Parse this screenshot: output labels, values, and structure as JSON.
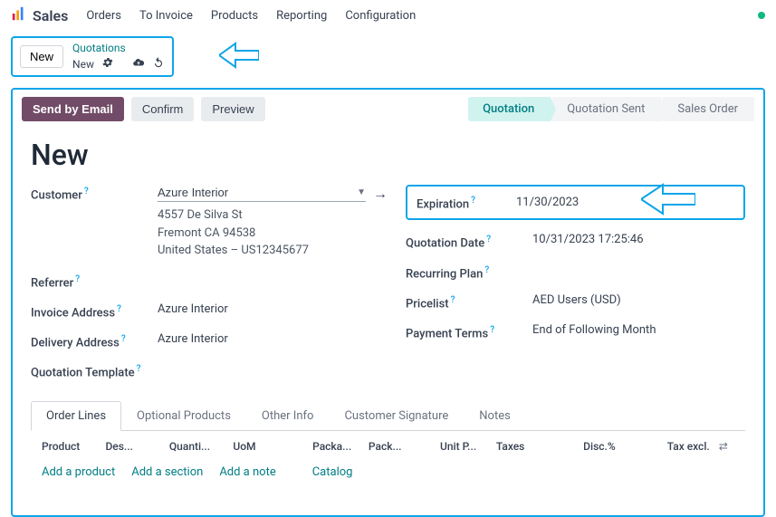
{
  "nav": {
    "brand": "Sales",
    "items": [
      "Orders",
      "To Invoice",
      "Products",
      "Reporting",
      "Configuration"
    ]
  },
  "crumb": {
    "new_btn": "New",
    "top": "Quotations",
    "bottom": "New"
  },
  "actions": {
    "send": "Send by Email",
    "confirm": "Confirm",
    "preview": "Preview"
  },
  "status": {
    "quotation": "Quotation",
    "sent": "Quotation Sent",
    "order": "Sales Order"
  },
  "form": {
    "title": "New",
    "left": {
      "customer_label": "Customer",
      "customer_value": "Azure Interior",
      "address1": "4557 De Silva St",
      "address2": "Fremont CA 94538",
      "address3": "United States – US12345677",
      "referrer_label": "Referrer",
      "invoice_addr_label": "Invoice Address",
      "invoice_addr_value": "Azure Interior",
      "delivery_addr_label": "Delivery Address",
      "delivery_addr_value": "Azure Interior",
      "qtpl_label": "Quotation Template"
    },
    "right": {
      "expiration_label": "Expiration",
      "expiration_value": "11/30/2023",
      "qdate_label": "Quotation Date",
      "qdate_value": "10/31/2023 17:25:46",
      "recurring_label": "Recurring Plan",
      "pricelist_label": "Pricelist",
      "pricelist_value": "AED Users (USD)",
      "payterms_label": "Payment Terms",
      "payterms_value": "End of Following Month"
    }
  },
  "tabs": {
    "order_lines": "Order Lines",
    "optional": "Optional Products",
    "other": "Other Info",
    "signature": "Customer Signature",
    "notes": "Notes"
  },
  "cols": {
    "product": "Product",
    "des": "Des...",
    "qty": "Quanti...",
    "uom": "UoM",
    "packa": "Packa...",
    "pack": "Pack...",
    "up": "Unit P...",
    "taxes": "Taxes",
    "disc": "Disc.%",
    "texcl": "Tax excl."
  },
  "line_actions": {
    "add_product": "Add a product",
    "add_section": "Add a section",
    "add_note": "Add a note",
    "catalog": "Catalog"
  }
}
